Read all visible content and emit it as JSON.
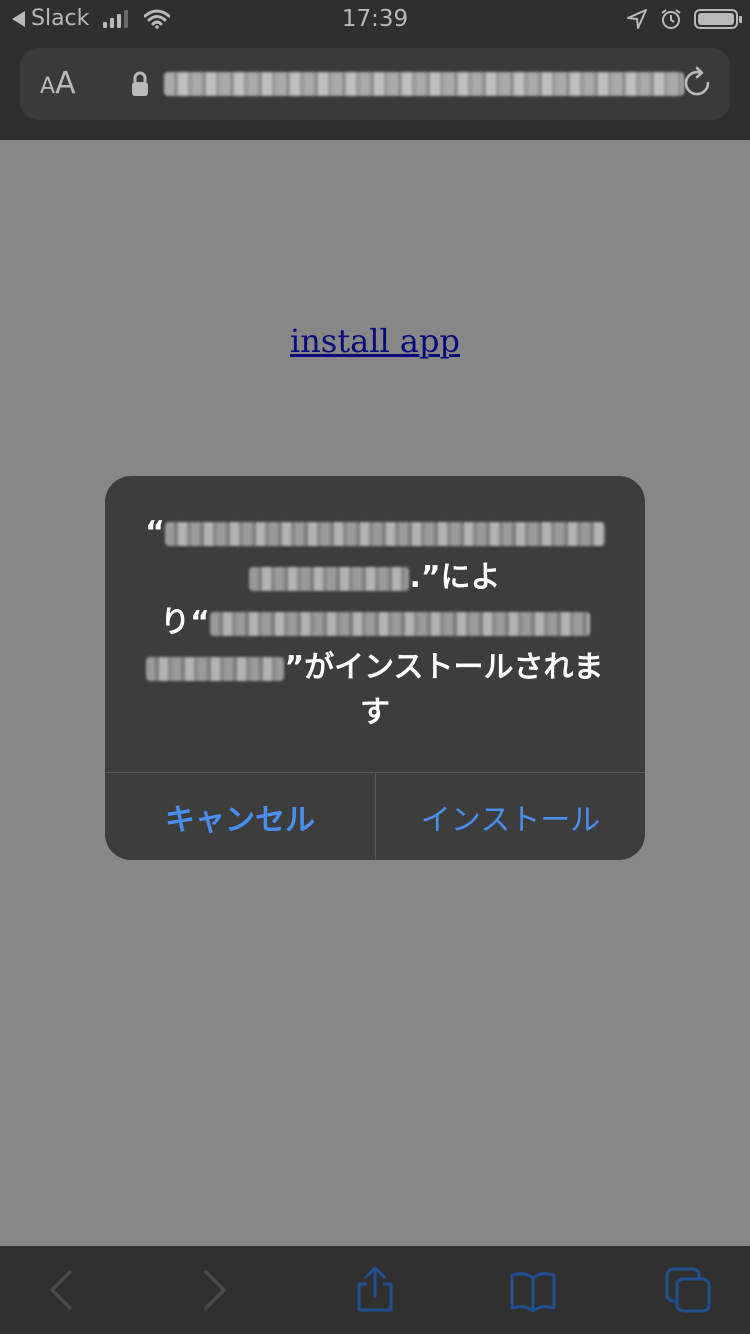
{
  "status_bar": {
    "back_label": "Slack",
    "time": "17:39"
  },
  "url_bar": {
    "text_size_label_small": "A",
    "text_size_label_big": "A"
  },
  "page": {
    "link_text": "install app"
  },
  "alert": {
    "quote_open": "“",
    "part1_suffix": ".”によ",
    "part2_prefix": "り“",
    "part2_suffix": "”がインストールされま",
    "part3": "す",
    "cancel_label": "キャンセル",
    "install_label": "インストール",
    "button_color": "#4a8ff0"
  },
  "colors": {
    "overlay_background": "#878787",
    "chrome_background": "#2f2f2f",
    "alert_background": "#3d3d3d",
    "link_color": "#0a0a7a"
  },
  "icons": [
    "back-arrow-icon",
    "cellular-signal-icon",
    "wifi-icon",
    "location-icon",
    "alarm-icon",
    "battery-icon",
    "lock-icon",
    "reload-icon",
    "chevron-left-icon",
    "chevron-right-icon",
    "share-icon",
    "bookmarks-icon",
    "tabs-icon"
  ]
}
